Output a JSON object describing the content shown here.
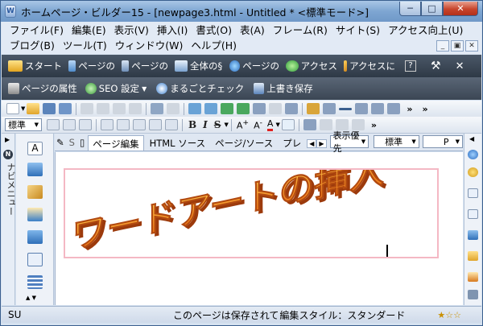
{
  "window": {
    "title": "ホームページ・ビルダー15 - [newpage3.html - Untitled * <標準モード>]",
    "app_icon_letter": "W"
  },
  "menu": {
    "row1": [
      "ファイル(F)",
      "編集(E)",
      "表示(V)",
      "挿入(I)",
      "書式(O)",
      "表(A)",
      "フレーム(R)",
      "サイト(S)",
      "アクセス向上(U)"
    ],
    "row2": [
      "ブログ(B)",
      "ツール(T)",
      "ウィンドウ(W)",
      "ヘルプ(H)"
    ]
  },
  "dark_toolbar": {
    "items": [
      "スタート",
      "ページの",
      "ページの",
      "全体の§",
      "ページの",
      "アクセス",
      "アクセスに"
    ]
  },
  "quick_toolbar": {
    "page_properties": "ページの属性",
    "seo_settings": "SEO 設定",
    "check_all": "まるごとチェック",
    "overwrite_save": "上書き保存"
  },
  "format_bar": {
    "paragraph_style": "標準",
    "bold": "B",
    "italic": "I",
    "strike": "S"
  },
  "view_tabs": {
    "s_label": "S",
    "page_edit": "ページ編集",
    "html_source": "HTML ソース",
    "page_source": "ページ/ソース",
    "preview": "プレ",
    "display_priority": "表示優先",
    "standard": "標準",
    "p_tag": "P"
  },
  "nav_panel": {
    "label": "ナビメニュー",
    "n_badge": "N"
  },
  "wordart": {
    "text": "ワードアートの挿入"
  },
  "status": {
    "left": "SU",
    "message": "このページは保存されて",
    "edit_style": "編集スタイル：スタンダード",
    "stars": "★☆☆"
  },
  "colors": {
    "wordart_fill": "#f28a18",
    "wordart_shadow": "#b53e0e",
    "frame_border": "#f4b8c4"
  }
}
